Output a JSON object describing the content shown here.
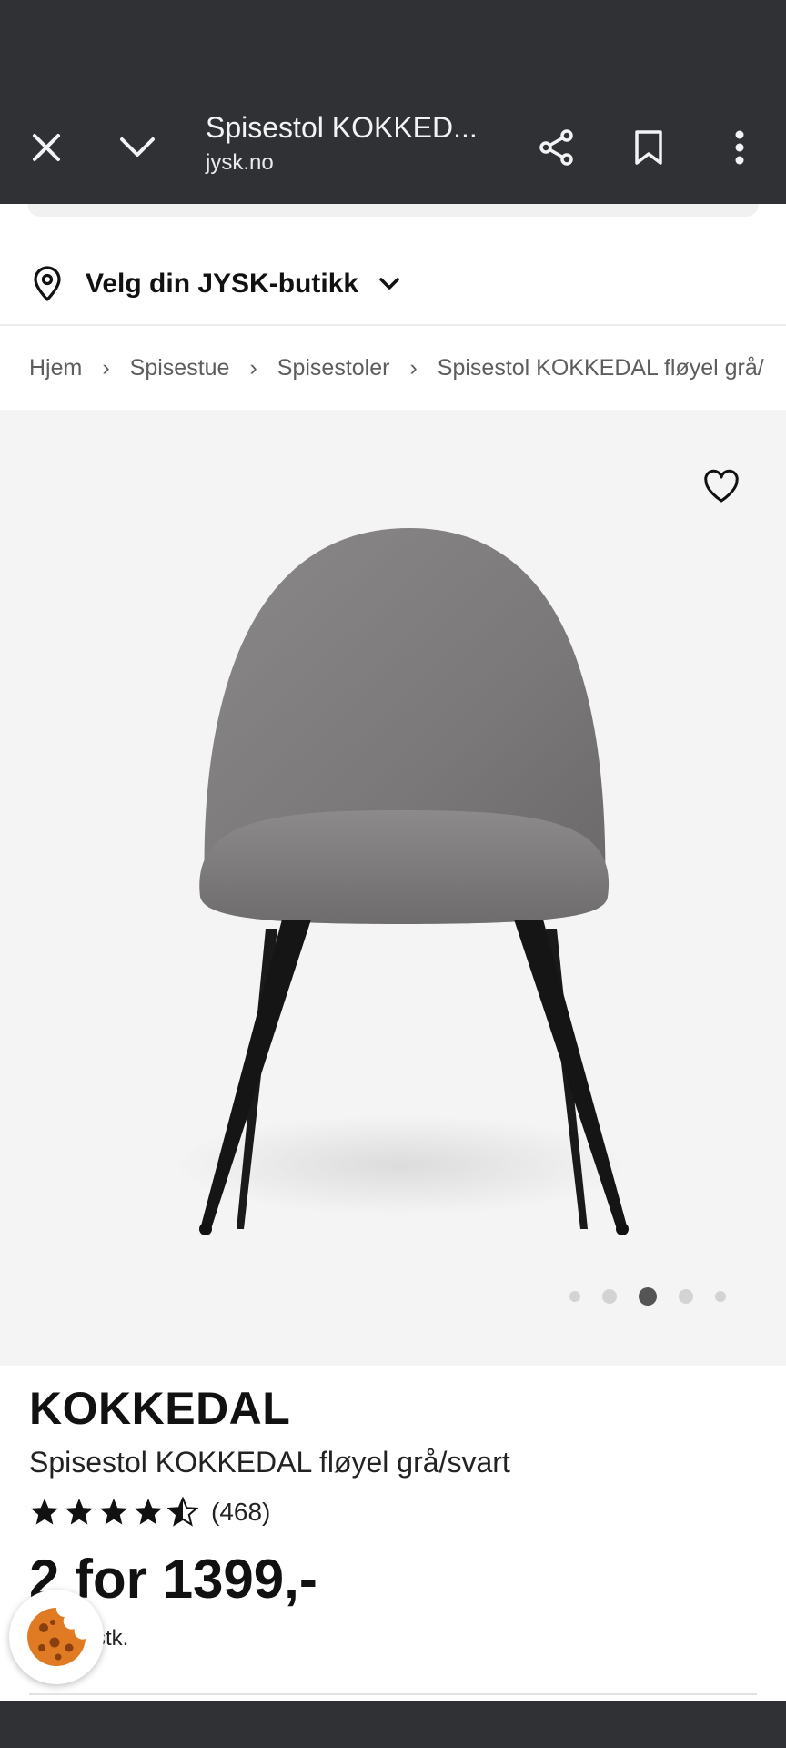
{
  "toolbar": {
    "title": "Spisestol KOKKED...",
    "url": "jysk.no"
  },
  "store": {
    "label": "Velg din JYSK-butikk"
  },
  "breadcrumb": [
    "Hjem",
    "Spisestue",
    "Spisestoler",
    "Spisestol KOKKEDAL fløyel grå/"
  ],
  "gallery": {
    "image_count": 5,
    "active_index": 2
  },
  "product": {
    "brand": "KOKKEDAL",
    "name": "Spisestol KOKKEDAL fløyel grå/svart",
    "rating": 4.5,
    "review_count": "(468)",
    "price": "2 for 1399,-",
    "unit": "stk."
  },
  "colors": {
    "toolbar_bg": "#303134",
    "gallery_bg": "#f4f4f4",
    "cookie": "#e07b24"
  }
}
